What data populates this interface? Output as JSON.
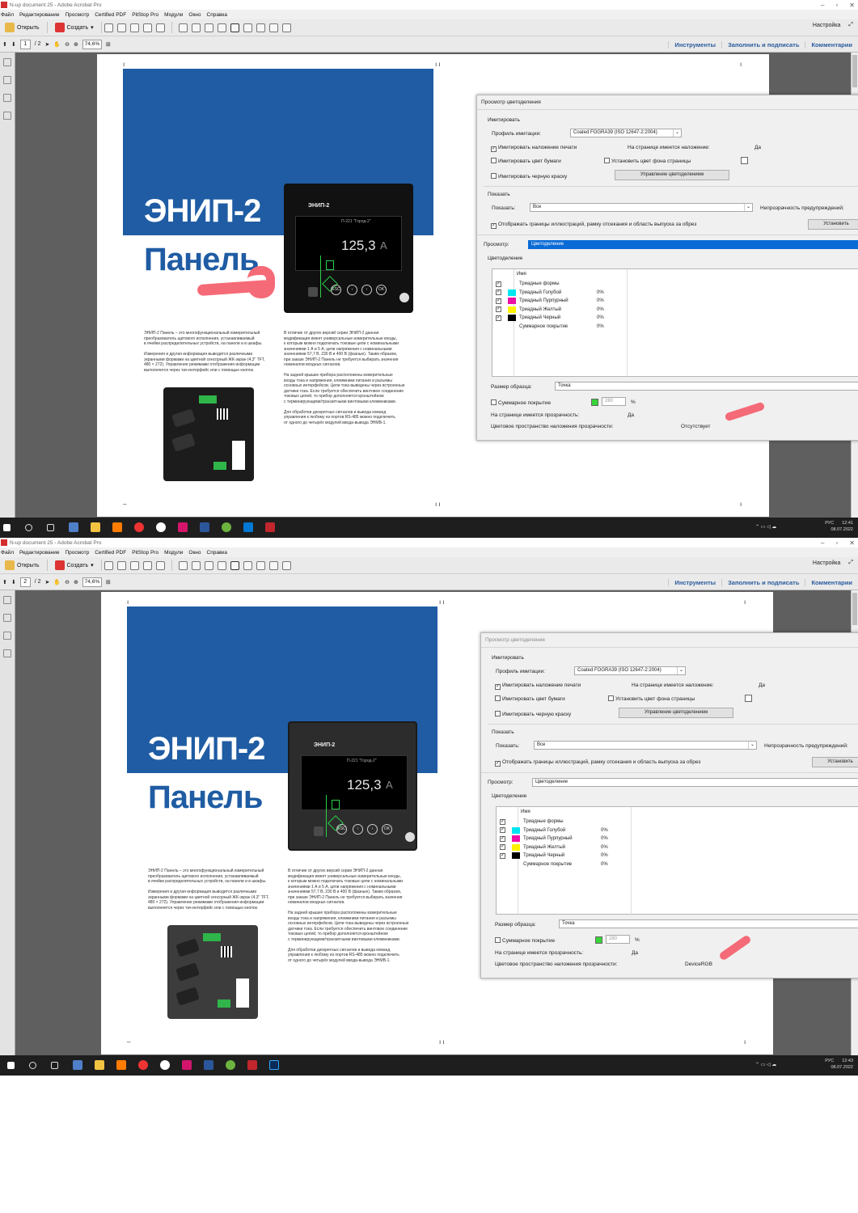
{
  "window": {
    "title_top": "N-up document 25 - Adobe Acrobat Pro",
    "title_bottom": "N-up document 25 - Adobe Acrobat Pro",
    "controls": [
      "–",
      "▫",
      "✕"
    ]
  },
  "menu": [
    "Файл",
    "Редактирование",
    "Просмотр",
    "Certified PDF",
    "PitStop Pro",
    "Модули",
    "Окно",
    "Справка"
  ],
  "toolbar": {
    "open": "Открыть",
    "create": "Создать",
    "customize": "Настройка"
  },
  "nav": {
    "page_top": "1",
    "page_bottom": "2",
    "page_total": "/ 2",
    "zoom": "74,6%",
    "tools": "Инструменты",
    "fill_sign": "Заполнить и подписать",
    "comments": "Комментарии"
  },
  "doc": {
    "title1": "ЭНИП-2",
    "title2": "Панель",
    "device_brand": "ЭНИП-2",
    "reading": "125,3",
    "unit": "A",
    "screen_label": "П-221 \"Город-2\"",
    "btn_esc": "ESC",
    "btn_ok": "OK",
    "col1": "ЭНИП-2 Панель – это многофункциональный измерительный\nпреобразователь щитового исполнения, устанавливаемый\nв ячейки распределительных устройств, на панели и в шкафы.\n\nИзмерения и другая информация выводится различными\nэкранными формами на цветной сенсорный ЖК-экран (4,3\" TFT,\n480 × 272). Управление режимами отображения информации\nвыполняется через тач-интерфейс или с помощью кнопок.",
    "col2": "В отличие от других версий серии ЭНИП-2 данная\nмодификация имеет универсальные измерительные входы,\nк которым можно подключать токовые цепи с номинальными\nзначениями 1 А и 5 А, цепи напряжения с номинальными\nзначениями 57,7 В, 230 В и 400 В (фазные). Таким образом,\nпри заказе ЭНИП-2 Панель не требуется выбирать значения\nноминалов входных сигналов.\n\nНа задней крышке прибора расположены измерительные\nвходы тока и напряжения, клеммники питания и разъемы\nосновных интерфейсов. Цепи тока выведены через встроенные\nдатчики тока. Если требуется обеспечить винтовое соединение\nтоковых цепей, то прибор дополняется кронштейном\nс терминирующими/транзитными винтовыми клеммниками.\n\nДля обработки дискретных сигналов и вывода команд\nуправления к любому из портов RS-485 можно подключить\nот одного до четырёх модулей ввода-вывода ЭНМВ-1."
  },
  "dialog": {
    "title": "Просмотр цветоделения",
    "simulate": "Имитировать",
    "profile_label": "Профиль имитации:",
    "profile_value": "Coated FOGRA39 (ISO 12647-2:2004)",
    "sim_overprint": "Имитировать наложение печати",
    "page_has_overprint": "На странице имеется наложение:",
    "yes": "Да",
    "sim_paper": "Имитировать цвет бумаги",
    "set_page_bg": "Установить цвет фона страницы",
    "sim_black": "Имитировать черную краску",
    "manage_btn": "Управление цветоделением",
    "show": "Показать",
    "show_label": "Показать:",
    "show_value": "Все",
    "warn_opacity": "Непрозрачность предупреждений:",
    "show_boxes": "Отображать границы иллюстраций, рамку отсекания и область выпуска за обрез",
    "set_btn": "Установить",
    "preview_label": "Просмотр:",
    "preview_value": "Цветоделение",
    "sep_section": "Цветоделение",
    "col_name": "Имя",
    "rows": [
      {
        "name": "Триадные формы",
        "color": "",
        "pct": "",
        "checked": true
      },
      {
        "name": "Триадный Голубой",
        "color": "#00e6f0",
        "pct": "0%",
        "checked": true
      },
      {
        "name": "Триадный Пурпурный",
        "color": "#ef0fa8",
        "pct": "0%",
        "checked": true
      },
      {
        "name": "Триадный Желтый",
        "color": "#fff200",
        "pct": "0%",
        "checked": true
      },
      {
        "name": "Триадный Черный",
        "color": "#000000",
        "pct": "0%",
        "checked": true
      },
      {
        "name": "Суммарное покрытие",
        "color": "",
        "pct": "0%",
        "checked": false
      }
    ],
    "sample_label": "Размер образца:",
    "sample_value": "Точка",
    "total_coverage": "Суммарное покрытие",
    "total_value": "280",
    "pct_sign": "%",
    "transparency_label": "На странице имеется прозрачность:",
    "transparency_value": "Да",
    "blend_label": "Цветовое пространство наложения прозрачности:",
    "blend_value_top": "Отсутствует",
    "blend_value_bottom": "DeviceRGB"
  },
  "taskbar": {
    "lang": "РУС",
    "time_top": "12:41",
    "time_bottom": "12:43",
    "date": "08.07.2022"
  },
  "colors": {
    "brand_blue": "#1f5ca3",
    "scribble": "#f56a77"
  }
}
